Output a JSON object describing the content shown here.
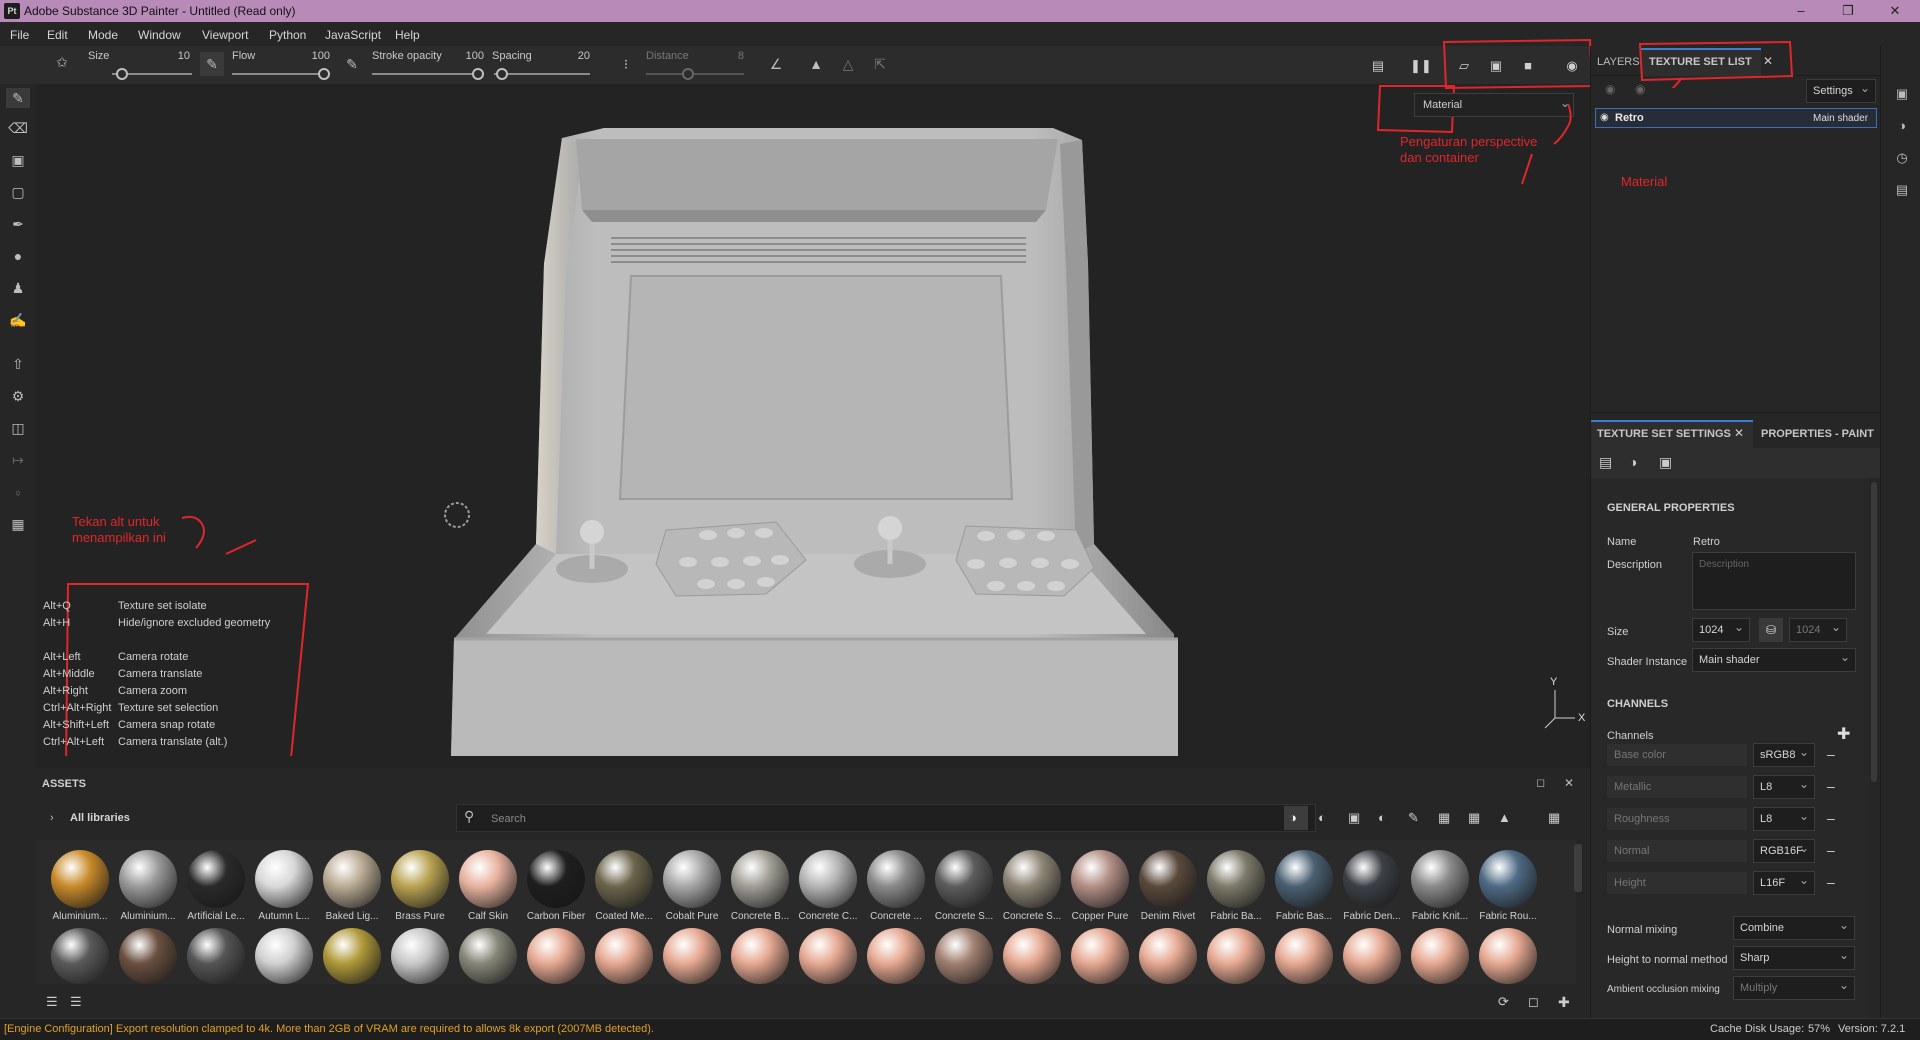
{
  "app": {
    "title": "Adobe Substance 3D Painter - Untitled (Read only)",
    "logo": "Pt"
  },
  "menu": [
    "File",
    "Edit",
    "Mode",
    "Window",
    "Viewport",
    "Python",
    "JavaScript",
    "Help"
  ],
  "tool_options": {
    "size_label": "Size",
    "size_value": "10",
    "flow_label": "Flow",
    "flow_value": "100",
    "stroke_opacity_label": "Stroke opacity",
    "stroke_opacity_value": "100",
    "spacing_label": "Spacing",
    "spacing_value": "20",
    "distance_label": "Distance",
    "distance_value": "8"
  },
  "viewport": {
    "material_select": "Material",
    "axis_y": "Y",
    "axis_x": "X"
  },
  "shortcuts": [
    {
      "key": "Alt+Q",
      "desc": "Texture set isolate"
    },
    {
      "key": "Alt+H",
      "desc": "Hide/ignore excluded geometry"
    },
    {
      "key": "Alt+Left",
      "desc": "Camera rotate"
    },
    {
      "key": "Alt+Middle",
      "desc": "Camera translate"
    },
    {
      "key": "Alt+Right",
      "desc": "Camera zoom"
    },
    {
      "key": "Ctrl+Alt+Right",
      "desc": "Texture set selection"
    },
    {
      "key": "Alt+Shift+Left",
      "desc": "Camera snap rotate"
    },
    {
      "key": "Ctrl+Alt+Left",
      "desc": "Camera translate (alt.)"
    }
  ],
  "annotations": {
    "alt_note_1": "Tekan alt untuk",
    "alt_note_2": "menampilkan ini",
    "persp_note_1": "Pengaturan perspective",
    "persp_note_2": "dan container",
    "material_note": "Material",
    "color": "#e0262b"
  },
  "top_panel": {
    "tab_layers": "LAYERS",
    "tab_texture_set_list": "TEXTURE SET LIST",
    "settings_label": "Settings",
    "texture_set_name": "Retro",
    "texture_set_shader": "Main shader"
  },
  "tss": {
    "tab_texture_set_settings": "TEXTURE SET SETTINGS",
    "tab_properties": "PROPERTIES - PAINT",
    "general_header": "GENERAL PROPERTIES",
    "name_label": "Name",
    "name_value": "Retro",
    "description_label": "Description",
    "description_placeholder": "Description",
    "size_label": "Size",
    "size_value": "1024",
    "size_value_2": "1024",
    "shader_label": "Shader Instance",
    "shader_value": "Main shader",
    "channels_header": "CHANNELS",
    "channels_label": "Channels",
    "channels": [
      {
        "name": "Base color",
        "format": "sRGB8"
      },
      {
        "name": "Metallic",
        "format": "L8"
      },
      {
        "name": "Roughness",
        "format": "L8"
      },
      {
        "name": "Normal",
        "format": "RGB16F"
      },
      {
        "name": "Height",
        "format": "L16F"
      }
    ],
    "normal_mixing_label": "Normal mixing",
    "normal_mixing_value": "Combine",
    "height_to_normal_label": "Height to normal method",
    "height_to_normal_value": "Sharp",
    "ao_mixing_label": "Ambient occlusion mixing",
    "ao_mixing_value": "Multiply"
  },
  "assets": {
    "title": "ASSETS",
    "library": "All libraries",
    "search_placeholder": "Search",
    "row1": [
      {
        "name": "Aluminium...",
        "color": "#c88a2a"
      },
      {
        "name": "Aluminium...",
        "color": "#9a9a9a"
      },
      {
        "name": "Artificial Le...",
        "color": "#2a2a2a"
      },
      {
        "name": "Autumn L...",
        "color": "#d8d8d8"
      },
      {
        "name": "Baked Lig...",
        "color": "#b9ab94"
      },
      {
        "name": "Brass Pure",
        "color": "#b9a352"
      },
      {
        "name": "Calf Skin",
        "color": "#e8b3a0"
      },
      {
        "name": "Carbon Fiber",
        "color": "#1e1e1e"
      },
      {
        "name": "Coated Me...",
        "color": "#6c654c"
      },
      {
        "name": "Cobalt Pure",
        "color": "#a8a8a8"
      },
      {
        "name": "Concrete B...",
        "color": "#a19e96"
      },
      {
        "name": "Concrete C...",
        "color": "#b5b5b5"
      },
      {
        "name": "Concrete ...",
        "color": "#8a8a8a"
      },
      {
        "name": "Concrete S...",
        "color": "#5c5c5c"
      },
      {
        "name": "Concrete S...",
        "color": "#8e8576"
      },
      {
        "name": "Copper Pure",
        "color": "#b38f86"
      },
      {
        "name": "Denim Rivet",
        "color": "#5a4a3c"
      },
      {
        "name": "Fabric Ba...",
        "color": "#7d7a6a"
      },
      {
        "name": "Fabric Bas...",
        "color": "#4a6072"
      },
      {
        "name": "Fabric Den...",
        "color": "#3c4046"
      },
      {
        "name": "Fabric Knit...",
        "color": "#8a8a8a"
      },
      {
        "name": "Fabric Rou...",
        "color": "#4f6b85"
      }
    ],
    "row2": [
      "#5a5a5a",
      "#6a5040",
      "#555555",
      "#d0d0d0",
      "#b09a3a",
      "#c8c8c8",
      "#868678",
      "#e6a992",
      "#e6a992",
      "#e6a992",
      "#e6a992",
      "#e6a992",
      "#e6a992",
      "#a08070",
      "#e6a992",
      "#e6a992",
      "#e6a992",
      "#e6a992",
      "#e6a992",
      "#e6a992",
      "#e6a992",
      "#e6a992"
    ]
  },
  "status": {
    "message": "[Engine Configuration] Export resolution clamped to 4k. More than 2GB of VRAM are required to allows 8k export (2007MB detected).",
    "cache": "Cache Disk Usage:",
    "cache_value": "57%",
    "version": "Version: 7.2.1"
  }
}
